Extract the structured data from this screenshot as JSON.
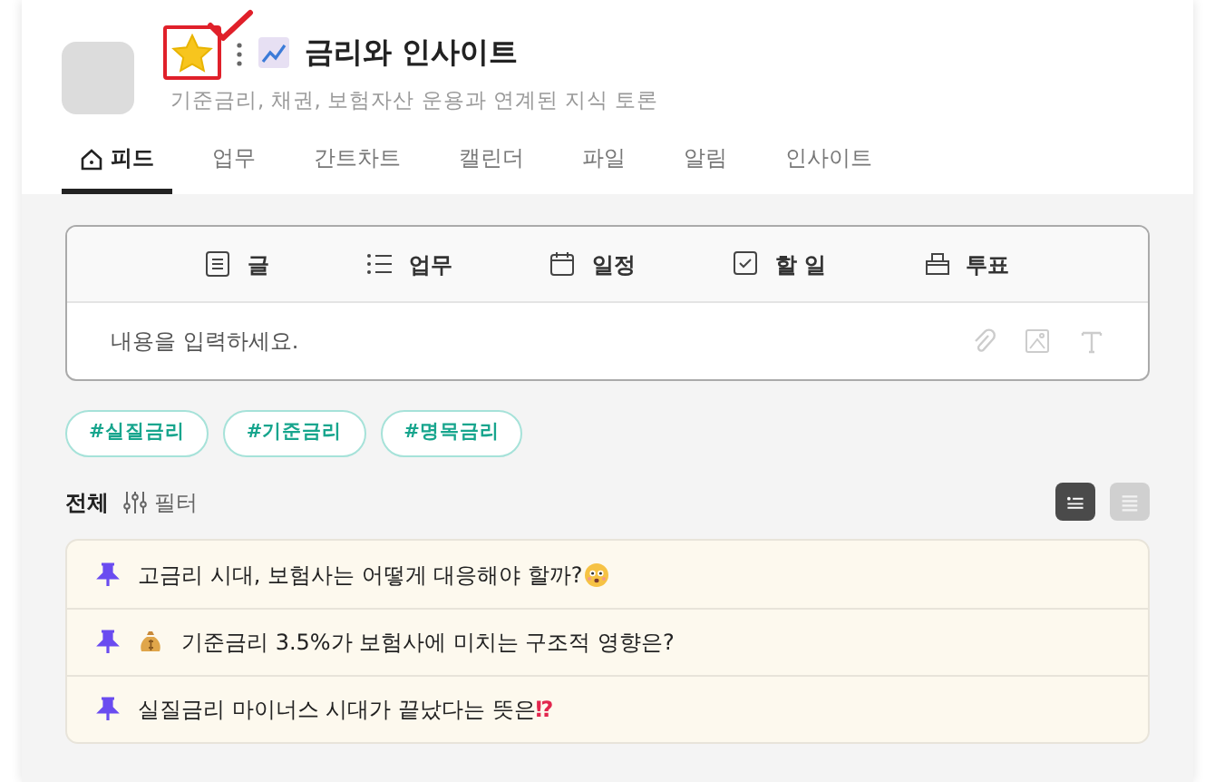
{
  "header": {
    "starred": true,
    "annotated": true,
    "title": "금리와 인사이트",
    "subtitle": "기준금리, 채권, 보험자산 운용과 연계된 지식 토론"
  },
  "tabs": [
    {
      "label": "피드",
      "selected": true,
      "home": true
    },
    {
      "label": "업무",
      "selected": false
    },
    {
      "label": "간트차트",
      "selected": false
    },
    {
      "label": "캘린더",
      "selected": false
    },
    {
      "label": "파일",
      "selected": false
    },
    {
      "label": "알림",
      "selected": false
    },
    {
      "label": "인사이트",
      "selected": false
    }
  ],
  "composer": {
    "types": [
      {
        "kind": "post",
        "label": "글"
      },
      {
        "kind": "task",
        "label": "업무"
      },
      {
        "kind": "schedule",
        "label": "일정"
      },
      {
        "kind": "todo",
        "label": "할 일"
      },
      {
        "kind": "vote",
        "label": "투표"
      }
    ],
    "placeholder": "내용을 입력하세요."
  },
  "tags": [
    "#실질금리",
    "#기준금리",
    "#명목금리"
  ],
  "filter": {
    "scope": "전체",
    "label": "필터"
  },
  "view_modes": [
    {
      "kind": "card",
      "selected": true
    },
    {
      "kind": "list",
      "selected": false
    }
  ],
  "posts": [
    {
      "title": "고금리 시대, 보험사는 어떻게 대응해야 할까?",
      "pinned": true,
      "emoji_after": true
    },
    {
      "title": "기준금리 3.5%가 보험사에 미치는 구조적 영향은?",
      "pinned": true,
      "emoji_before": true
    },
    {
      "title": "실질금리 마이너스 시대가 끝났다는 뜻은",
      "pinned": true,
      "suffix": "⁉"
    }
  ]
}
